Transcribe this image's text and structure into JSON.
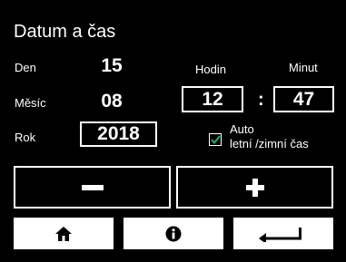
{
  "header": {
    "title": "Datum a čas"
  },
  "date": {
    "day_label": "Den",
    "day_value": "15",
    "month_label": "Měsíc",
    "month_value": "08",
    "year_label": "Rok",
    "year_value": "2018"
  },
  "time": {
    "hour_label": "Hodin",
    "hour_value": "12",
    "separator": ":",
    "minute_label": "Minut",
    "minute_value": "47"
  },
  "dst": {
    "checked": true,
    "label_line1": "Auto",
    "label_line2": "letní /zimní čas",
    "check_color": "#1fae6b"
  },
  "controls": {
    "minus_icon": "minus-icon",
    "plus_icon": "plus-icon"
  },
  "nav": {
    "home_icon": "home-icon",
    "info_icon": "info-icon",
    "back_icon": "back-icon"
  }
}
